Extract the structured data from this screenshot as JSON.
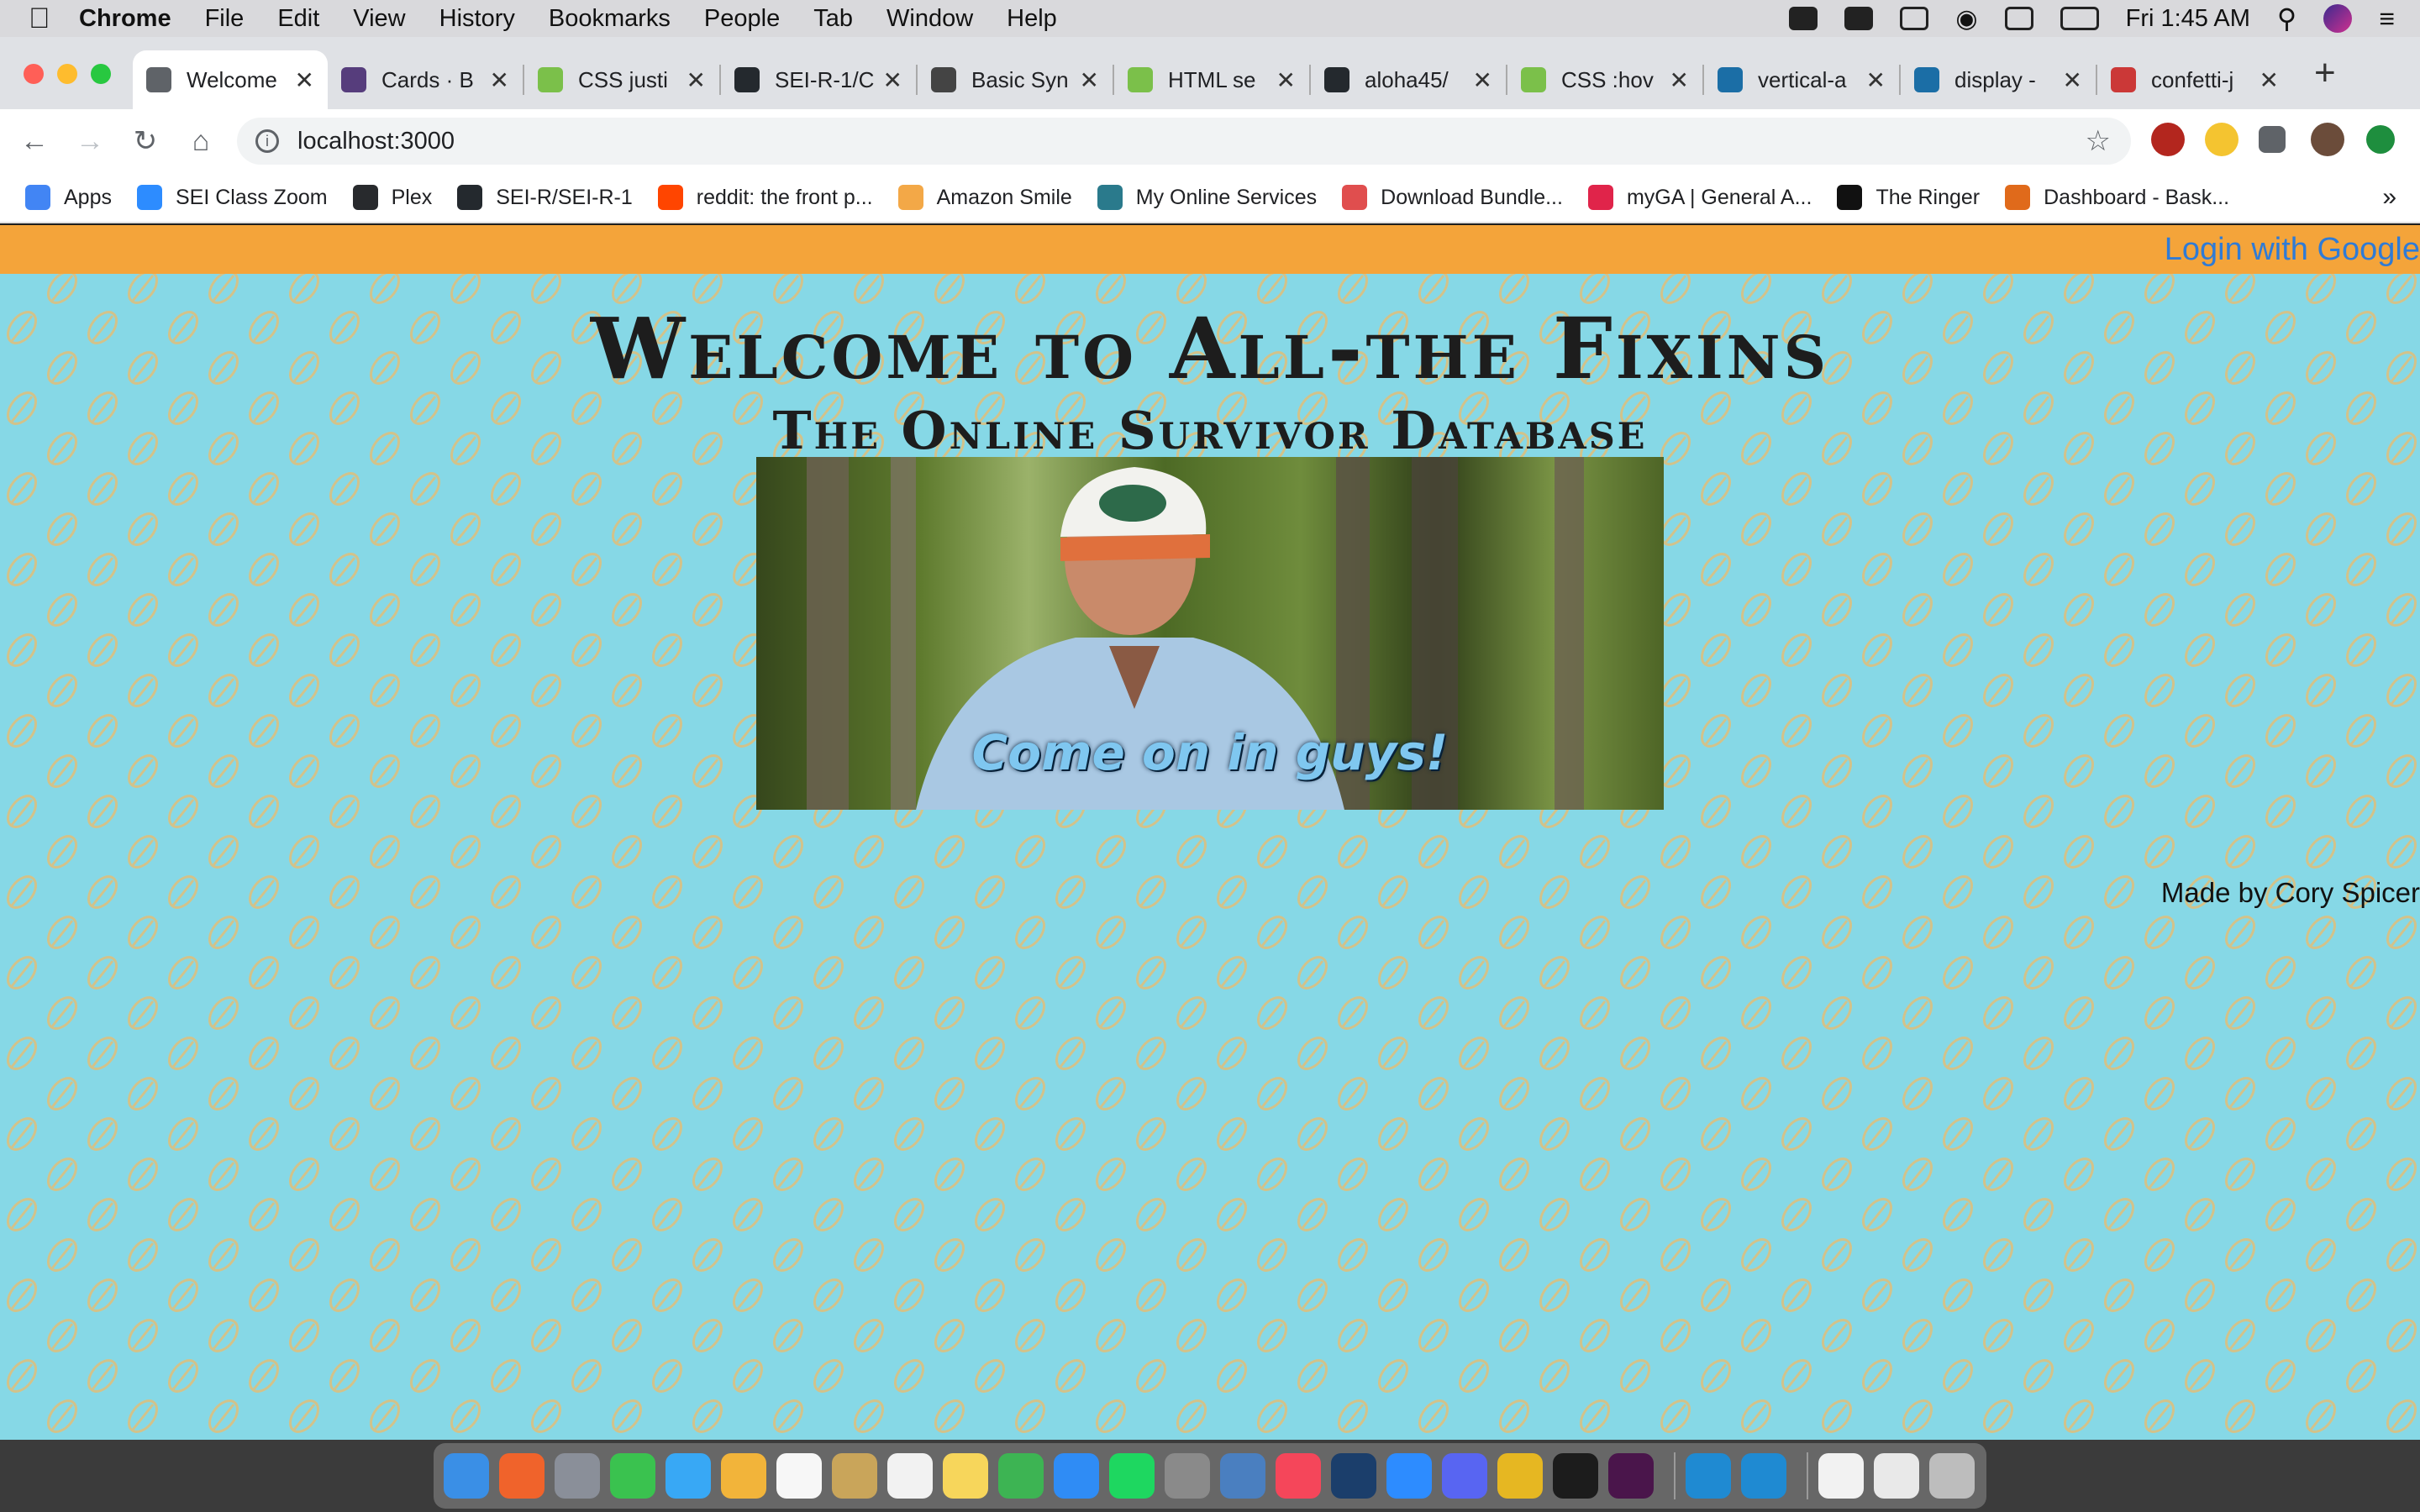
{
  "menubar": {
    "app_name": "Chrome",
    "items": [
      "File",
      "Edit",
      "View",
      "History",
      "Bookmarks",
      "People",
      "Tab",
      "Window",
      "Help"
    ],
    "clock": "Fri 1:45 AM"
  },
  "tabs": [
    {
      "title": "Welcome",
      "favicon": "globe-icon",
      "color": "#5f6368",
      "active": true
    },
    {
      "title": "Cards · B",
      "favicon": "bootstrap-icon",
      "color": "#563d7c",
      "active": false
    },
    {
      "title": "CSS justi",
      "favicon": "w3schools-icon",
      "color": "#7bc04a",
      "active": false
    },
    {
      "title": "SEI-R-1/C",
      "favicon": "github-icon",
      "color": "#24292e",
      "active": false
    },
    {
      "title": "Basic Syn",
      "favicon": "markdown-icon",
      "color": "#444444",
      "active": false
    },
    {
      "title": "HTML se",
      "favicon": "w3schools-icon",
      "color": "#7bc04a",
      "active": false
    },
    {
      "title": "aloha45/",
      "favicon": "github-icon",
      "color": "#24292e",
      "active": false
    },
    {
      "title": "CSS :hov",
      "favicon": "w3schools-icon",
      "color": "#7bc04a",
      "active": false
    },
    {
      "title": "vertical-a",
      "favicon": "mdn-icon",
      "color": "#1b6ea6",
      "active": false
    },
    {
      "title": "display -",
      "favicon": "mdn-icon",
      "color": "#1b6ea6",
      "active": false
    },
    {
      "title": "confetti-j",
      "favicon": "npm-icon",
      "color": "#cb3837",
      "active": false
    }
  ],
  "address_bar": {
    "url": "localhost:3000"
  },
  "bookmarks": [
    {
      "label": "Apps",
      "icon": "apps-grid-icon",
      "color": "#4285f4"
    },
    {
      "label": "SEI Class Zoom",
      "icon": "zoom-icon",
      "color": "#2d8cff"
    },
    {
      "label": "Plex",
      "icon": "plex-icon",
      "color": "#282a2d"
    },
    {
      "label": "SEI-R/SEI-R-1",
      "icon": "github-icon",
      "color": "#24292e"
    },
    {
      "label": "reddit: the front p...",
      "icon": "reddit-icon",
      "color": "#ff4500"
    },
    {
      "label": "Amazon Smile",
      "icon": "amazon-icon",
      "color": "#f3a847"
    },
    {
      "label": "My Online Services",
      "icon": "services-icon",
      "color": "#2a7a8c"
    },
    {
      "label": "Download Bundle...",
      "icon": "bundle-icon",
      "color": "#e04e4e"
    },
    {
      "label": "myGA | General A...",
      "icon": "ga-icon",
      "color": "#e0244a"
    },
    {
      "label": "The Ringer",
      "icon": "ringer-icon",
      "color": "#111111"
    },
    {
      "label": "Dashboard - Bask...",
      "icon": "basketball-icon",
      "color": "#e06a1b"
    }
  ],
  "page": {
    "login_link": "Login with Google",
    "heading": "Welcome to All-the Fixins",
    "subheading": "The Online Survivor Database",
    "gif_caption": "Come on in guys!",
    "credit": "Made by Cory Spicer"
  },
  "colors": {
    "page_background": "#86d8e6",
    "nav_strip": "#f4a43a",
    "login_link": "#2f7bd6",
    "pattern_leaf": "#e0bf7a"
  },
  "dock": {
    "apps": [
      {
        "name": "finder-icon",
        "color": "#3a8fe6"
      },
      {
        "name": "brave-icon",
        "color": "#f0632b"
      },
      {
        "name": "launchpad-icon",
        "color": "#8a8f99"
      },
      {
        "name": "facetime-icon",
        "color": "#3ac24f"
      },
      {
        "name": "messages-icon",
        "color": "#38a8f5"
      },
      {
        "name": "photos-icon",
        "color": "#f2b43a"
      },
      {
        "name": "calendar-icon",
        "color": "#f7f7f7"
      },
      {
        "name": "notebook-icon",
        "color": "#c9a55a"
      },
      {
        "name": "reminders-icon",
        "color": "#f2f2f2"
      },
      {
        "name": "notes-icon",
        "color": "#f7d65b"
      },
      {
        "name": "numbers-icon",
        "color": "#3db453"
      },
      {
        "name": "app-store-icon",
        "color": "#2f8cf5"
      },
      {
        "name": "spotify-icon",
        "color": "#1ed760"
      },
      {
        "name": "system-preferences-icon",
        "color": "#8a8a8a"
      },
      {
        "name": "preview-icon",
        "color": "#4a7fc0"
      },
      {
        "name": "news-icon",
        "color": "#f5465a"
      },
      {
        "name": "steam-icon",
        "color": "#1b3e6b"
      },
      {
        "name": "zoom-icon",
        "color": "#2d8cff"
      },
      {
        "name": "discord-icon",
        "color": "#5865f2"
      },
      {
        "name": "chrome-icon",
        "color": "#e6b722"
      },
      {
        "name": "terminal-icon",
        "color": "#1c1c1c"
      },
      {
        "name": "slack-icon",
        "color": "#4a154b"
      },
      {
        "name": "vscode-icon",
        "color": "#1f8ad2"
      },
      {
        "name": "vscode-insiders-icon",
        "color": "#1f8ad2"
      },
      {
        "name": "textedit-icon",
        "color": "#f2f2f2"
      },
      {
        "name": "document-icon",
        "color": "#e9e9e9"
      },
      {
        "name": "trash-icon",
        "color": "#bdbdbd"
      }
    ]
  }
}
